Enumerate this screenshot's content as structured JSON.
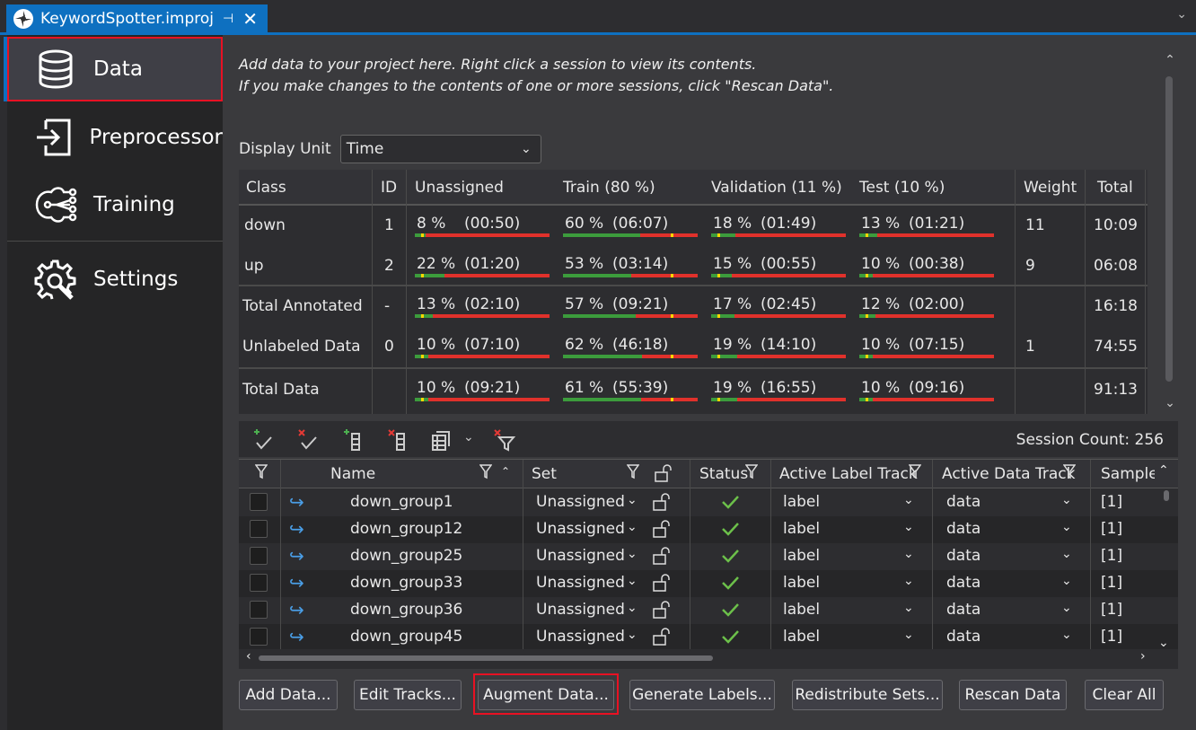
{
  "tab": {
    "title": "KeywordSpotter.improj",
    "pin": "⊣",
    "close": "✕"
  },
  "sidebar": {
    "data": "Data",
    "preprocessor": "Preprocessor",
    "training": "Training",
    "settings": "Settings"
  },
  "intro": {
    "line1": "Add data to your project here. Right click a session to view its contents.",
    "line2": "If you make changes to the contents of one or more sessions, click \"Rescan Data\"."
  },
  "display_unit": {
    "label": "Display Unit",
    "value": "Time"
  },
  "stats": {
    "headers": {
      "class": "Class",
      "id": "ID",
      "unassigned": "Unassigned",
      "train": "Train (80 %)",
      "validation": "Validation (11 %)",
      "test": "Test (10 %)",
      "weight": "Weight",
      "total": "Total"
    },
    "rows": [
      {
        "class": "down",
        "id": "1",
        "un_p": "8 %",
        "un_t": "(00:50)",
        "tr_p": "60 %",
        "tr_t": "(06:07)",
        "va_p": "18 %",
        "va_t": "(01:49)",
        "te_p": "13 %",
        "te_t": "(01:21)",
        "weight": "11",
        "total": "10:09"
      },
      {
        "class": "up",
        "id": "2",
        "un_p": "22 %",
        "un_t": "(01:20)",
        "tr_p": "53 %",
        "tr_t": "(03:14)",
        "va_p": "15 %",
        "va_t": "(00:55)",
        "te_p": "10 %",
        "te_t": "(00:38)",
        "weight": "9",
        "total": "06:08"
      },
      {
        "class": "Total Annotated",
        "id": "-",
        "un_p": "13 %",
        "un_t": "(02:10)",
        "tr_p": "57 %",
        "tr_t": "(09:21)",
        "va_p": "17 %",
        "va_t": "(02:45)",
        "te_p": "12 %",
        "te_t": "(02:00)",
        "weight": "",
        "total": "16:18"
      },
      {
        "class": "Unlabeled Data",
        "id": "0",
        "un_p": "10 %",
        "un_t": "(07:10)",
        "tr_p": "62 %",
        "tr_t": "(46:18)",
        "va_p": "19 %",
        "va_t": "(14:10)",
        "te_p": "10 %",
        "te_t": "(07:15)",
        "weight": "1",
        "total": "74:55"
      },
      {
        "class": "Total Data",
        "id": "",
        "un_p": "10 %",
        "un_t": "(09:21)",
        "tr_p": "61 %",
        "tr_t": "(55:39)",
        "va_p": "19 %",
        "va_t": "(16:55)",
        "te_p": "10 %",
        "te_t": "(09:16)",
        "weight": "",
        "total": "91:13"
      }
    ]
  },
  "session_count": "Session Count: 256",
  "grid": {
    "headers": {
      "name": "Name",
      "set": "Set",
      "status": "Status",
      "label_track": "Active Label Track",
      "data_track": "Active Data Track",
      "sample": "Sample"
    },
    "rows": [
      {
        "name": "down_group1",
        "set": "Unassigned",
        "label": "label",
        "data": "data",
        "sample": "[1]"
      },
      {
        "name": "down_group12",
        "set": "Unassigned",
        "label": "label",
        "data": "data",
        "sample": "[1]"
      },
      {
        "name": "down_group25",
        "set": "Unassigned",
        "label": "label",
        "data": "data",
        "sample": "[1]"
      },
      {
        "name": "down_group33",
        "set": "Unassigned",
        "label": "label",
        "data": "data",
        "sample": "[1]"
      },
      {
        "name": "down_group36",
        "set": "Unassigned",
        "label": "label",
        "data": "data",
        "sample": "[1]"
      },
      {
        "name": "down_group45",
        "set": "Unassigned",
        "label": "label",
        "data": "data",
        "sample": "[1]"
      }
    ]
  },
  "buttons": {
    "add": "Add Data...",
    "edit": "Edit Tracks...",
    "augment": "Augment Data...",
    "generate": "Generate Labels...",
    "redistribute": "Redistribute Sets...",
    "rescan": "Rescan Data",
    "clear": "Clear All"
  }
}
